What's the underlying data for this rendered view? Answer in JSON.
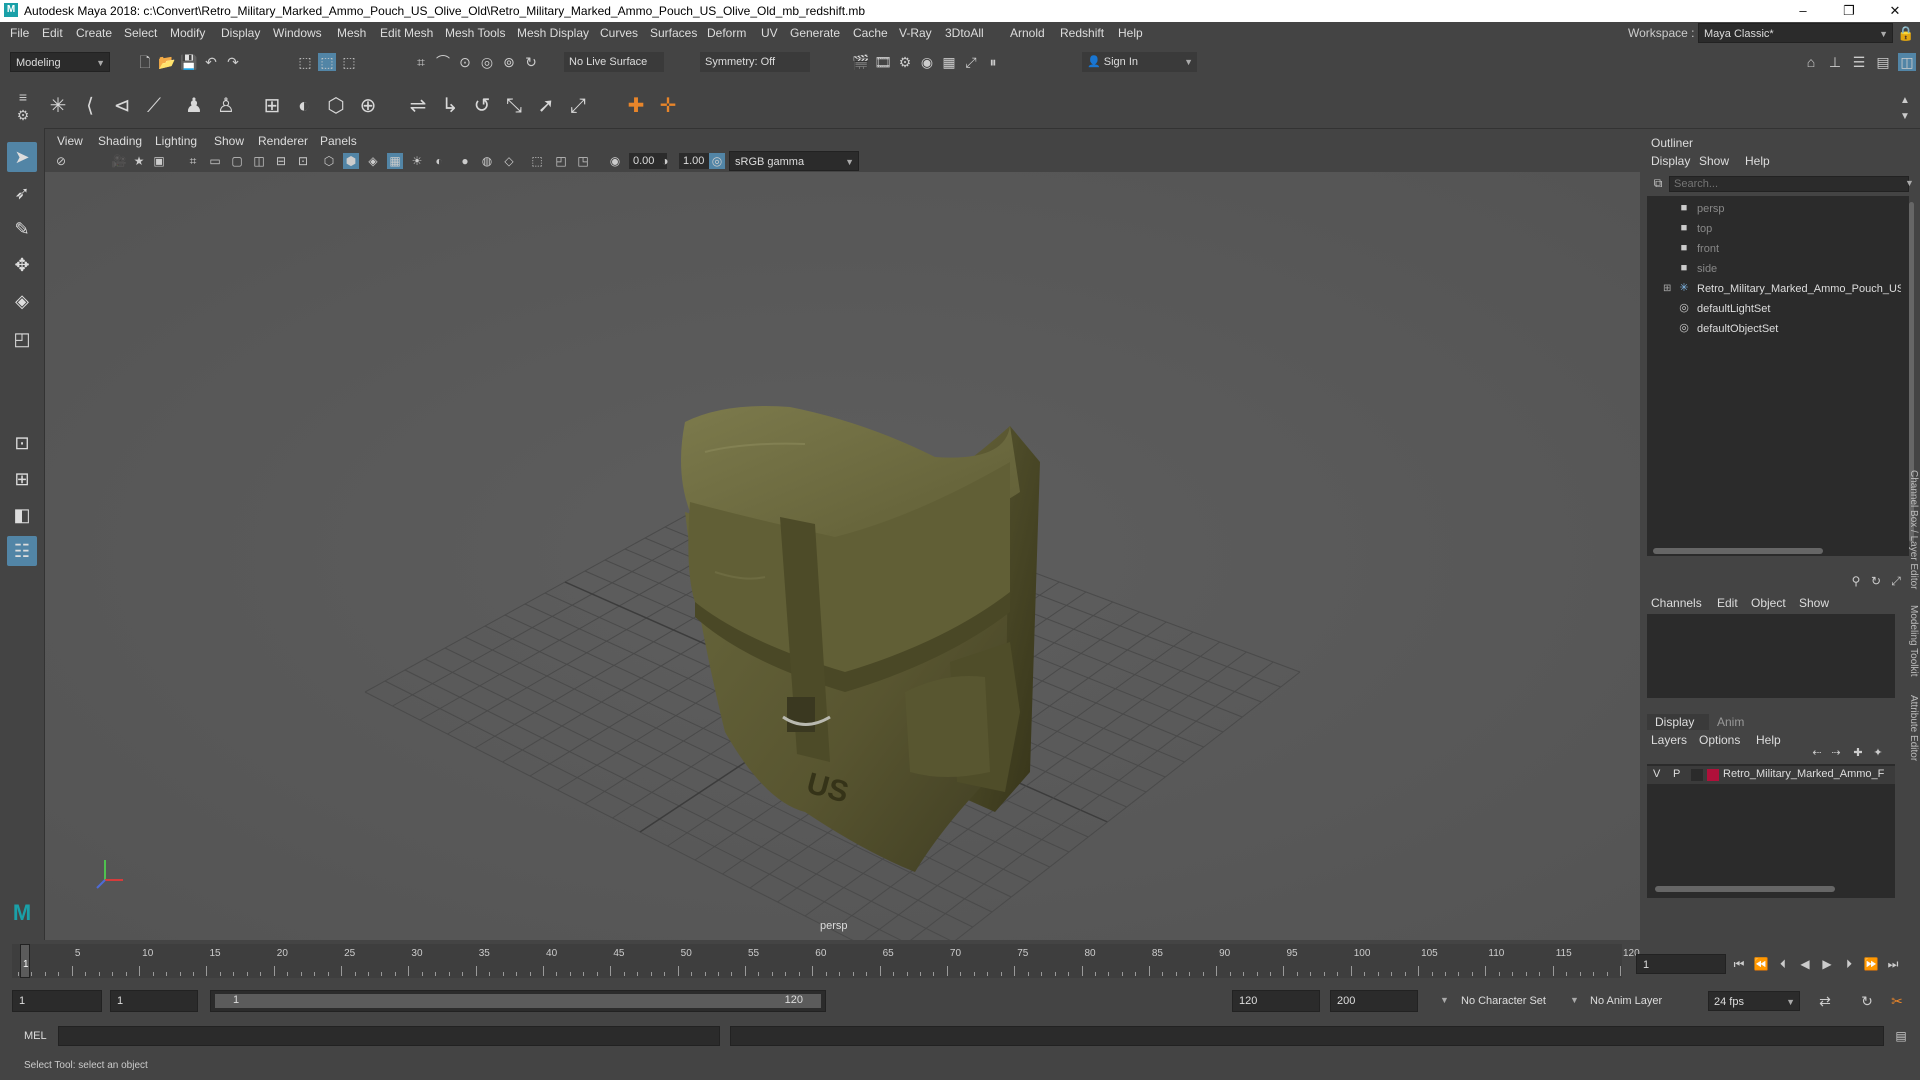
{
  "titlebar": {
    "title": "Autodesk Maya 2018: c:\\Convert\\Retro_Military_Marked_Ammo_Pouch_US_Olive_Old\\Retro_Military_Marked_Ammo_Pouch_US_Olive_Old_mb_redshift.mb",
    "minimize": "–",
    "maximize": "❐",
    "close": "✕"
  },
  "menubar": {
    "items": [
      "File",
      "Edit",
      "Create",
      "Select",
      "Modify",
      "Display",
      "Windows",
      "Mesh",
      "Edit Mesh",
      "Mesh Tools",
      "Mesh Display",
      "Curves",
      "Surfaces",
      "Deform",
      "UV",
      "Generate",
      "Cache",
      "V-Ray",
      "3DtoAll",
      "Arnold",
      "Redshift",
      "Help"
    ],
    "workspace_label": "Workspace :",
    "workspace_value": "Maya Classic*"
  },
  "statusline": {
    "mode": "Modeling",
    "live_surface": "No Live Surface",
    "symmetry": "Symmetry: Off",
    "sign_in": "Sign In"
  },
  "viewport": {
    "menus": [
      "View",
      "Shading",
      "Lighting",
      "Show",
      "Renderer",
      "Panels"
    ],
    "exposure": "0.00",
    "gamma": "1.00",
    "color_space": "sRGB gamma",
    "camera_label": "persp"
  },
  "outliner": {
    "title": "Outliner",
    "menus": [
      "Display",
      "Show",
      "Help"
    ],
    "search_placeholder": "Search...",
    "items": [
      {
        "label": "persp",
        "icon": "camera-icon",
        "dim": true
      },
      {
        "label": "top",
        "icon": "camera-icon",
        "dim": true
      },
      {
        "label": "front",
        "icon": "camera-icon",
        "dim": true
      },
      {
        "label": "side",
        "icon": "camera-icon",
        "dim": true
      },
      {
        "label": "Retro_Military_Marked_Ammo_Pouch_US",
        "icon": "group-icon",
        "dim": false
      },
      {
        "label": "defaultLightSet",
        "icon": "set-icon",
        "dim": false
      },
      {
        "label": "defaultObjectSet",
        "icon": "set-icon",
        "dim": false
      }
    ]
  },
  "channelbox": {
    "menus": [
      "Channels",
      "Edit",
      "Object",
      "Show"
    ],
    "side_tab": "Channel Box / Layer Editor"
  },
  "layers": {
    "tabs": [
      "Display",
      "Anim"
    ],
    "menus": [
      "Layers",
      "Options",
      "Help"
    ],
    "row": {
      "v": "V",
      "p": "P",
      "name": "Retro_Military_Marked_Ammo_F",
      "color": "#b0103a"
    }
  },
  "side_tabs": [
    "Modeling Toolkit",
    "Attribute Editor"
  ],
  "timeline": {
    "ticks": [
      "5",
      "10",
      "15",
      "20",
      "25",
      "30",
      "35",
      "40",
      "45",
      "50",
      "55",
      "60",
      "65",
      "70",
      "75",
      "80",
      "85",
      "90",
      "95",
      "100",
      "105",
      "110",
      "115",
      "120"
    ],
    "current_frame_marker": "1",
    "current_frame_field": "1"
  },
  "range": {
    "start": "1",
    "start2": "1",
    "slider_start": "1",
    "slider_end": "120",
    "end": "120",
    "end2": "200",
    "character_set": "No Character Set",
    "anim_layer": "No Anim Layer",
    "fps": "24 fps"
  },
  "cmdline": {
    "label": "MEL"
  },
  "helpline": {
    "text": "Select Tool: select an object"
  },
  "colors": {
    "accent": "#5285a6",
    "panel": "#444444",
    "viewport": "#5b5b5b"
  }
}
